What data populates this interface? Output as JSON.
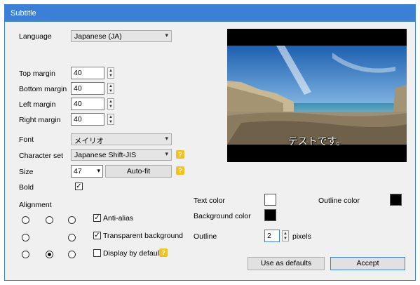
{
  "window": {
    "title": "Subtitle"
  },
  "language": {
    "label": "Language",
    "value": "Japanese (JA)"
  },
  "margins": {
    "top": {
      "label": "Top margin",
      "value": "40"
    },
    "bottom": {
      "label": "Bottom margin",
      "value": "40"
    },
    "left": {
      "label": "Left margin",
      "value": "40"
    },
    "right": {
      "label": "Right margin",
      "value": "40"
    }
  },
  "font": {
    "label": "Font",
    "value": "メイリオ"
  },
  "charset": {
    "label": "Character set",
    "value": "Japanese Shift-JIS"
  },
  "size": {
    "label": "Size",
    "value": "47",
    "autofit_label": "Auto-fit"
  },
  "bold": {
    "label": "Bold",
    "checked": true
  },
  "alignment": {
    "label": "Alignment",
    "selected": "bottom-center"
  },
  "options": {
    "anti_alias": {
      "label": "Anti-alias",
      "checked": true
    },
    "transparent_bg": {
      "label": "Transparent background",
      "checked": true
    },
    "display_default": {
      "label": "Display by default",
      "checked": false
    }
  },
  "preview": {
    "subtitle_text": "テストです。"
  },
  "colors": {
    "text": {
      "label": "Text color",
      "value": "#ffffff"
    },
    "outline": {
      "label": "Outline color",
      "value": "#000000"
    },
    "background": {
      "label": "Background color",
      "value": "#000000"
    }
  },
  "outline": {
    "label": "Outline",
    "value": "2",
    "unit": "pixels"
  },
  "buttons": {
    "defaults": "Use as defaults",
    "accept": "Accept"
  },
  "help_glyph": "?",
  "check_glyph": "✓",
  "arrow_glyph": "▾",
  "spin_up_glyph": "▲",
  "spin_down_glyph": "▼",
  "accent_color": "#3a80d8"
}
